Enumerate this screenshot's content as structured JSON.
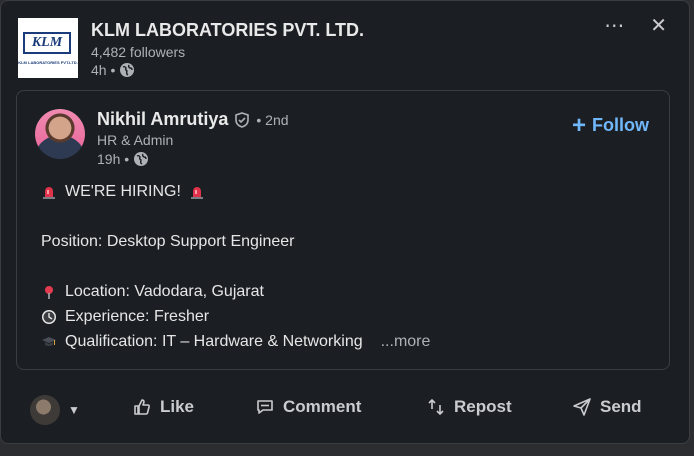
{
  "company": {
    "logo_text": "KLM",
    "logo_subtext": "KLM LABORATORIES PVT.LTD.",
    "name": "KLM LABORATORIES PVT. LTD.",
    "followers": "4,482 followers",
    "time": "4h •"
  },
  "repost": {
    "author_name": "Nikhil Amrutiya",
    "degree": "• 2nd",
    "title": "HR & Admin",
    "time": "19h •",
    "follow_label": "Follow",
    "lines": {
      "hiring": "WE'RE HIRING!",
      "position": "Position: Desktop Support Engineer",
      "location": "Location: Vadodara, Gujarat",
      "experience": "Experience: Fresher",
      "qualification": "Qualification: IT – Hardware & Networking",
      "more": "...more"
    }
  },
  "actions": {
    "like": "Like",
    "comment": "Comment",
    "repost": "Repost",
    "send": "Send"
  },
  "colors": {
    "background": "#1b1f23",
    "accent": "#71b7fb",
    "muted": "#aeb1b5"
  }
}
